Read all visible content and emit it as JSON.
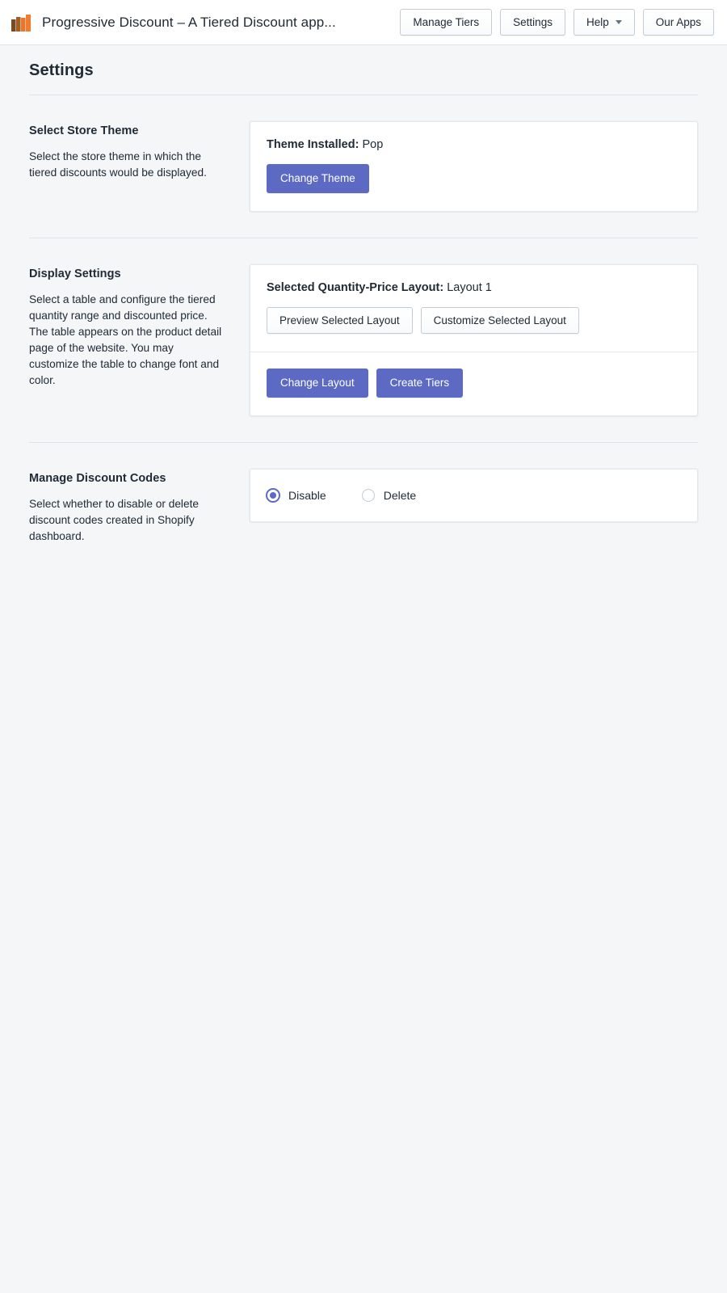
{
  "appbar": {
    "logo_icon": "bar-chart-logo-icon",
    "title": "Progressive Discount – A Tiered Discount app...",
    "actions": [
      {
        "label": "Manage Tiers",
        "name": "manage-tiers-button",
        "caret": false
      },
      {
        "label": "Settings",
        "name": "settings-button",
        "caret": false
      },
      {
        "label": "Help",
        "name": "help-button",
        "caret": true
      },
      {
        "label": "Our Apps",
        "name": "our-apps-button",
        "caret": false
      }
    ]
  },
  "page": {
    "title": "Settings"
  },
  "colors": {
    "primary": "#5c6ac4",
    "page_background": "#f4f6f8",
    "card_background": "#ffffff",
    "border": "#dfe3e8",
    "text": "#212b36",
    "logo_orange": "#e8762c",
    "logo_brown": "#7a4a20"
  },
  "sections": {
    "store_theme": {
      "title": "Select Store Theme",
      "description": "Select the store theme in which the tiered discounts would be displayed.",
      "heading_label": "Theme Installed:",
      "heading_value": "Pop",
      "change_theme_label": "Change Theme"
    },
    "display_settings": {
      "title": "Display Settings",
      "description": "Select a table and configure the tiered quantity range and discounted price. The table appears on the product detail page of the website. You may customize the table to change font and color.",
      "heading_label": "Selected Quantity-Price Layout:",
      "heading_value": "Layout 1",
      "preview_label": "Preview Selected Layout",
      "customize_label": "Customize Selected Layout",
      "change_layout_label": "Change Layout",
      "create_tiers_label": "Create Tiers"
    },
    "discount_codes": {
      "title": "Manage Discount Codes",
      "description": "Select whether to disable or delete discount codes created in Shopify dashboard.",
      "options": [
        {
          "label": "Disable",
          "selected": true
        },
        {
          "label": "Delete",
          "selected": false
        }
      ]
    }
  }
}
